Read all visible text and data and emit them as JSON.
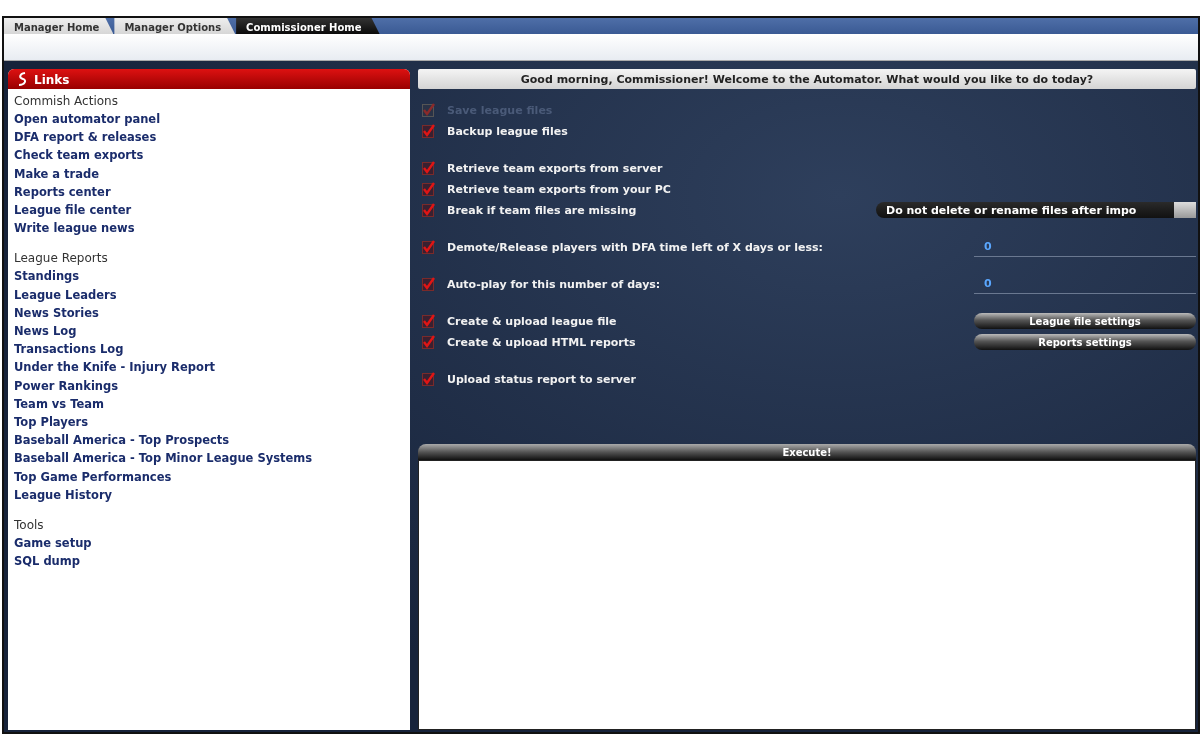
{
  "tabs": [
    {
      "label": "Manager Home",
      "selected": false
    },
    {
      "label": "Manager Options",
      "selected": false
    },
    {
      "label": "Commissioner Home",
      "selected": true
    }
  ],
  "links_panel": {
    "title": "Links",
    "sections": [
      {
        "heading": "Commish Actions",
        "items": [
          "Open automator panel",
          "DFA report & releases",
          "Check team exports",
          "Make a trade",
          "Reports center",
          "League file center",
          "Write league news"
        ]
      },
      {
        "heading": "League Reports",
        "items": [
          "Standings",
          "League Leaders",
          "News Stories",
          "News Log",
          "Transactions Log",
          "Under the Knife - Injury Report",
          "Power Rankings",
          "Team vs Team",
          "Top Players",
          "Baseball America - Top Prospects",
          "Baseball America - Top Minor League Systems",
          "Top Game Performances",
          "League History"
        ]
      },
      {
        "heading": "Tools",
        "items": [
          "Game setup",
          "SQL dump"
        ]
      }
    ]
  },
  "automator": {
    "greeting": "Good morning, Commissioner! Welcome to the Automator. What would you like to do today?",
    "groups": [
      [
        {
          "label": "Save league files",
          "checked": true,
          "disabled": true
        },
        {
          "label": "Backup league files",
          "checked": true,
          "disabled": false
        }
      ],
      [
        {
          "label": "Retrieve team exports from server",
          "checked": true,
          "disabled": false
        },
        {
          "label": "Retrieve team exports from your PC",
          "checked": true,
          "disabled": false
        },
        {
          "label": "Break if team files are missing",
          "checked": true,
          "disabled": false,
          "kind": "dropdown",
          "value": "Do not delete or rename files after impo"
        }
      ],
      [
        {
          "label": "Demote/Release players with DFA time left of X days or less:",
          "checked": true,
          "disabled": false,
          "kind": "number",
          "value": "0"
        }
      ],
      [
        {
          "label": "Auto-play for this number of days:",
          "checked": true,
          "disabled": false,
          "kind": "number",
          "value": "0"
        }
      ],
      [
        {
          "label": "Create & upload league file",
          "checked": true,
          "disabled": false,
          "kind": "button",
          "value": "League file settings"
        },
        {
          "label": "Create & upload HTML reports",
          "checked": true,
          "disabled": false,
          "kind": "button",
          "value": "Reports settings"
        }
      ],
      [
        {
          "label": "Upload status report to server",
          "checked": true,
          "disabled": false
        }
      ]
    ],
    "execute_button": "Execute!"
  }
}
